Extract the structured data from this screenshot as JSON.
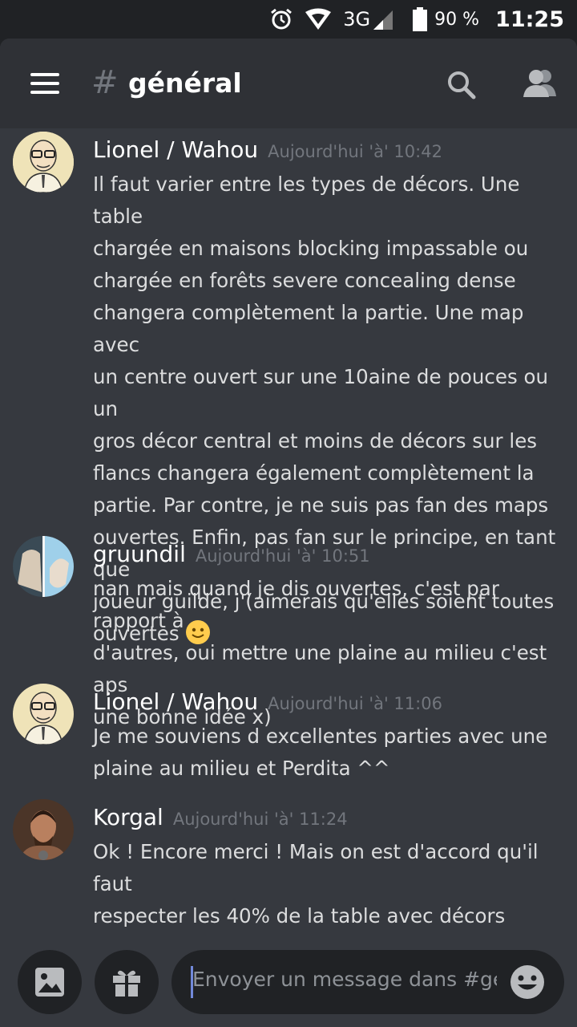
{
  "status_bar": {
    "network": "3G",
    "battery_percent": "90 %",
    "battery_level": 0.9,
    "time": "11:25"
  },
  "header": {
    "channel_hash": "#",
    "channel_name": "général",
    "icons": [
      "menu-icon",
      "search-icon",
      "members-icon"
    ]
  },
  "messages": [
    {
      "author": "Lionel / Wahou",
      "timestamp": "Aujourd'hui 'à' 10:42",
      "lines": [
        "Il faut varier entre les types de décors. Une table",
        "chargée en maisons blocking impassable ou",
        "chargée en forêts severe concealing dense",
        "changera complètement la partie. Une map avec",
        "un centre ouvert sur une 10aine de pouces ou un",
        "gros décor central et moins de décors sur les",
        "flancs  changera également complètement la",
        "partie. Par contre, je ne suis pas fan des maps",
        "ouvertes. Enfin, pas fan sur le principe, en tant que",
        "joueur guilde, j'(aimerais qu'elles soient toutes",
        "ouvertes"
      ],
      "trailing_emoji": "slightly-smiling-face-emoji"
    },
    {
      "author": "gruundil",
      "timestamp": "Aujourd'hui 'à' 10:51",
      "lines": [
        "nan mais quand je dis ouvertes, c'est par rapport à",
        "d'autres, oui mettre une plaine au milieu c'est aps",
        "une bonne idée x)"
      ]
    },
    {
      "author": "Lionel / Wahou",
      "timestamp": "Aujourd'hui 'à' 11:06",
      "lines": [
        "Je me souviens d excellentes parties avec une",
        "plaine au milieu et Perdita ^^"
      ]
    },
    {
      "author": "Korgal",
      "timestamp": "Aujourd'hui 'à' 11:24",
      "lines": [
        "Ok ! Encore merci ! Mais on est d'accord qu'il faut",
        "respecter les 40% de la table avec décors"
      ]
    }
  ],
  "composer": {
    "placeholder": "Envoyer un message dans #gé...",
    "icons": [
      "image-icon",
      "gift-icon",
      "emoji-icon"
    ]
  },
  "colors": {
    "background": "#36393f",
    "header": "#2f3136",
    "input": "#202225",
    "accent": "#7289da",
    "timestamp": "#72767d"
  }
}
